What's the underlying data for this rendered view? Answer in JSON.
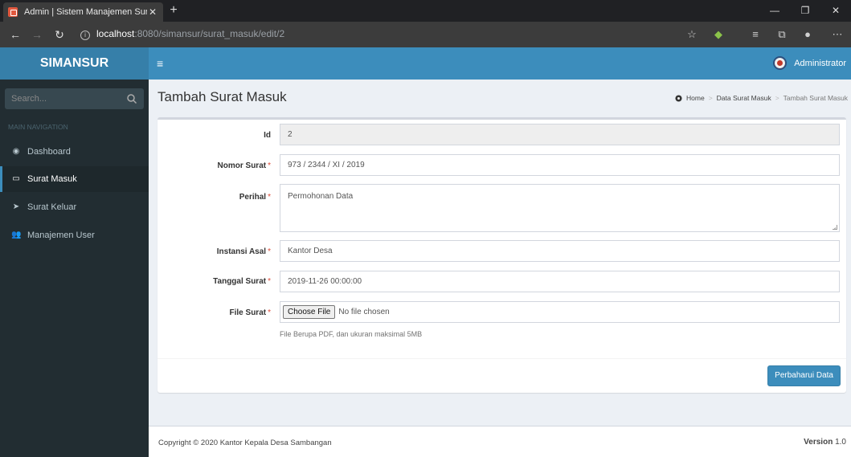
{
  "browser": {
    "tab_title": "Admin | Sistem Manajemen Sura",
    "url_host": "localhost",
    "url_rest": ":8080/simansur/surat_masuk/edit/2"
  },
  "header": {
    "brand": "SIMANSUR",
    "user_name": "Administrator"
  },
  "sidebar": {
    "search_placeholder": "Search...",
    "nav_header": "MAIN NAVIGATION",
    "items": [
      {
        "label": "Dashboard",
        "icon": "dashboard-icon"
      },
      {
        "label": "Surat Masuk",
        "icon": "inbox-icon",
        "active": true
      },
      {
        "label": "Surat Keluar",
        "icon": "send-icon"
      },
      {
        "label": "Manajemen User",
        "icon": "users-icon"
      }
    ]
  },
  "page": {
    "title": "Tambah Surat Masuk",
    "breadcrumb": [
      "Home",
      "Data Surat Masuk",
      "Tambah Surat Masuk"
    ]
  },
  "form": {
    "required_mark": "*",
    "id": {
      "label": "Id",
      "value": "2"
    },
    "nomor_surat": {
      "label": "Nomor Surat",
      "value": "973 / 2344 / XI / 2019"
    },
    "perihal": {
      "label": "Perihal",
      "value": "Permohonan Data"
    },
    "instansi_asal": {
      "label": "Instansi Asal",
      "value": "Kantor Desa"
    },
    "tanggal_surat": {
      "label": "Tanggal Surat",
      "value": "2019-11-26 00:00:00"
    },
    "file_surat": {
      "label": "File Surat",
      "button": "Choose File",
      "status": "No file chosen",
      "help": "File Berupa PDF, dan ukuran maksimal 5MB"
    },
    "submit_label": "Perbaharui Data"
  },
  "footer": {
    "copyright": "Copyright © 2020 Kantor Kepala Desa Sambangan",
    "version_label": "Version",
    "version_value": "1.0"
  },
  "colors": {
    "primary": "#3c8dbc",
    "logo_bg": "#367fa9",
    "sidebar_bg": "#222d32",
    "required": "#dd4b39"
  }
}
